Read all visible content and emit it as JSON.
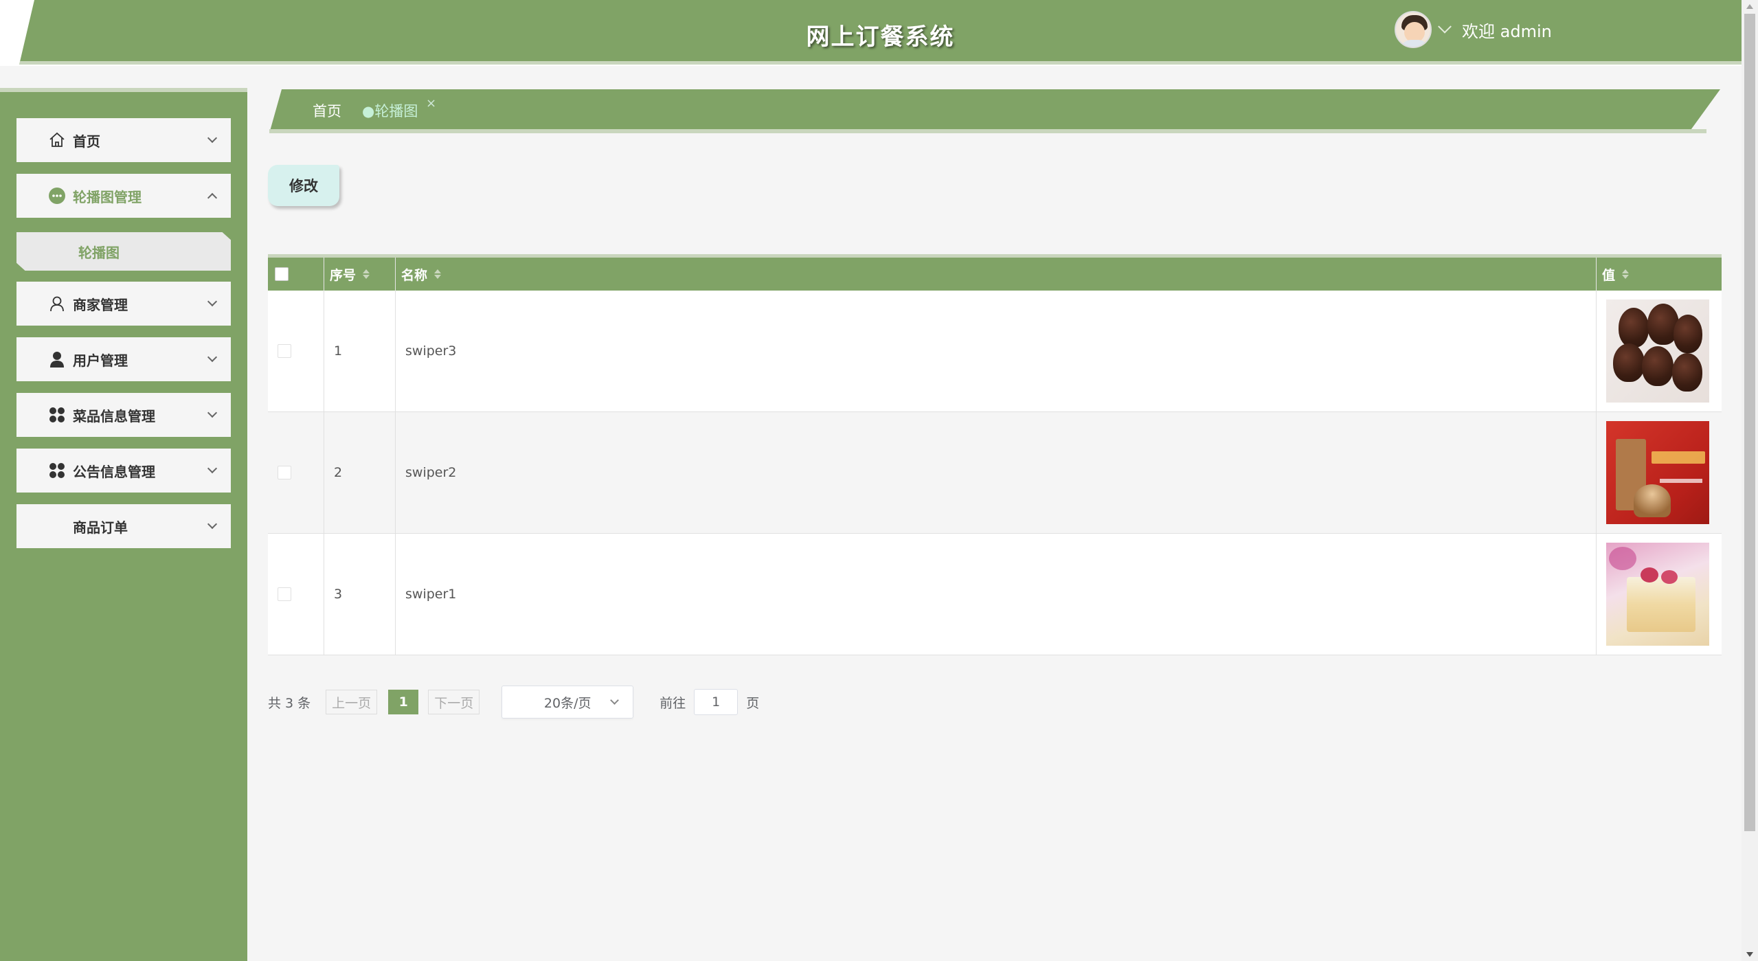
{
  "header": {
    "title": "网上订餐系统",
    "welcome": "欢迎 admin"
  },
  "sidebar": {
    "items": [
      {
        "label": "首页",
        "icon": "home-icon"
      },
      {
        "label": "轮播图管理",
        "icon": "more-circle-icon"
      },
      {
        "label": "商家管理",
        "icon": "user-outline-icon"
      },
      {
        "label": "用户管理",
        "icon": "user-solid-icon"
      },
      {
        "label": "菜品信息管理",
        "icon": "grid-icon"
      },
      {
        "label": "公告信息管理",
        "icon": "grid-icon"
      },
      {
        "label": "商品订单",
        "icon": ""
      }
    ],
    "submenu": {
      "label": "轮播图"
    }
  },
  "tags": {
    "home": "首页",
    "active": "●轮播图",
    "close": "×"
  },
  "toolbar": {
    "edit_label": "修改"
  },
  "table": {
    "columns": [
      "序号",
      "名称",
      "值"
    ],
    "rows": [
      {
        "index": "1",
        "name": "swiper3",
        "image": "chocolate-strawberries"
      },
      {
        "index": "2",
        "name": "swiper2",
        "image": "healthy-food-banner"
      },
      {
        "index": "3",
        "name": "swiper1",
        "image": "strawberry-cake"
      }
    ]
  },
  "pagination": {
    "total": "共 3 条",
    "prev": "上一页",
    "current": "1",
    "next": "下一页",
    "page_size": "20条/页",
    "goto": "前往",
    "goto_value": "1",
    "page_unit": "页"
  },
  "colors": {
    "primary": "#80a366",
    "tag_active": "#c6f0d8",
    "edit_button": "#d7f1ee"
  }
}
